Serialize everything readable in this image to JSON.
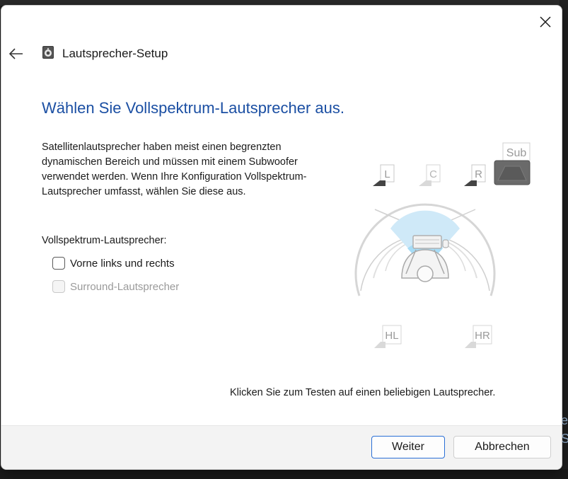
{
  "background": {
    "right_glyphs": [
      "e",
      "S"
    ]
  },
  "dialog": {
    "title": "Lautsprecher-Setup",
    "heading": "Wählen Sie Vollspektrum-Lautsprecher aus.",
    "description": "Satellitenlautsprecher haben meist einen begrenzten dynamischen Bereich und müssen mit einem Subwoofer verwendet werden. Wenn Ihre Konfiguration Vollspektrum-Lautsprecher umfasst, wählen Sie diese aus.",
    "group_label": "Vollspektrum-Lautsprecher:",
    "options": [
      {
        "label": "Vorne links und rechts",
        "checked": false,
        "enabled": true
      },
      {
        "label": "Surround-Lautsprecher",
        "checked": false,
        "enabled": false
      }
    ],
    "speakers": {
      "front_left": "L",
      "center": "C",
      "front_right": "R",
      "subwoofer": "Sub",
      "rear_left": "HL",
      "rear_right": "HR"
    },
    "instruction": "Klicken Sie zum Testen auf einen beliebigen Lautsprecher.",
    "buttons": {
      "next": "Weiter",
      "cancel": "Abbrechen"
    }
  },
  "icons": {
    "close": "close-icon",
    "back": "back-arrow-icon",
    "app": "speaker-icon"
  },
  "colors": {
    "heading": "#1b4fa3",
    "primary_border": "#2a6fd6",
    "listening_zone": "#a6dcf6"
  }
}
